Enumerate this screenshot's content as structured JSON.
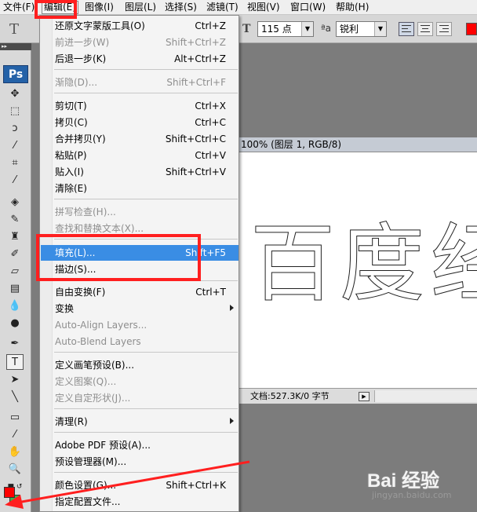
{
  "menubar": {
    "items": [
      {
        "label": "文件(F)"
      },
      {
        "label": "编辑(E)",
        "active": true
      },
      {
        "label": "图像(I)"
      },
      {
        "label": "图层(L)"
      },
      {
        "label": "选择(S)"
      },
      {
        "label": "滤镜(T)"
      },
      {
        "label": "视图(V)"
      },
      {
        "label": "窗口(W)"
      },
      {
        "label": "帮助(H)"
      }
    ]
  },
  "options_bar": {
    "font_size": "115 点",
    "antialias": "锐利",
    "color": "#ff0000"
  },
  "toolbox": {
    "logo": "Ps",
    "foreground_color": "#ff0000",
    "background_color": "#39b54a"
  },
  "document": {
    "title": "100% (图层 1, RGB/8)",
    "status": "文档:527.3K/0 字节",
    "text_chars": [
      "百",
      "度",
      "经"
    ]
  },
  "edit_menu": {
    "items": [
      {
        "label": "还原文字蒙版工具(O)",
        "shortcut": "Ctrl+Z"
      },
      {
        "label": "前进一步(W)",
        "shortcut": "Shift+Ctrl+Z",
        "disabled": true
      },
      {
        "label": "后退一步(K)",
        "shortcut": "Alt+Ctrl+Z"
      },
      {
        "label": "渐隐(D)...",
        "shortcut": "Shift+Ctrl+F",
        "disabled": true
      },
      {
        "label": "剪切(T)",
        "shortcut": "Ctrl+X"
      },
      {
        "label": "拷贝(C)",
        "shortcut": "Ctrl+C"
      },
      {
        "label": "合并拷贝(Y)",
        "shortcut": "Shift+Ctrl+C"
      },
      {
        "label": "粘贴(P)",
        "shortcut": "Ctrl+V"
      },
      {
        "label": "贴入(I)",
        "shortcut": "Shift+Ctrl+V"
      },
      {
        "label": "清除(E)",
        "shortcut": ""
      },
      {
        "label": "拼写检查(H)...",
        "shortcut": "",
        "disabled": true
      },
      {
        "label": "查找和替换文本(X)...",
        "shortcut": "",
        "disabled": true
      },
      {
        "label": "填充(L)...",
        "shortcut": "Shift+F5",
        "highlighted": true
      },
      {
        "label": "描边(S)...",
        "shortcut": ""
      },
      {
        "label": "自由变换(F)",
        "shortcut": "Ctrl+T"
      },
      {
        "label": "变换",
        "shortcut": "",
        "submenu": true
      },
      {
        "label": "Auto-Align Layers...",
        "shortcut": "",
        "disabled": true
      },
      {
        "label": "Auto-Blend Layers",
        "shortcut": "",
        "disabled": true
      },
      {
        "label": "定义画笔预设(B)...",
        "shortcut": ""
      },
      {
        "label": "定义图案(Q)...",
        "shortcut": "",
        "disabled": true
      },
      {
        "label": "定义自定形状(J)...",
        "shortcut": "",
        "disabled": true
      },
      {
        "label": "清理(R)",
        "shortcut": "",
        "submenu": true
      },
      {
        "label": "Adobe PDF 预设(A)...",
        "shortcut": ""
      },
      {
        "label": "预设管理器(M)...",
        "shortcut": ""
      },
      {
        "label": "颜色设置(G)...",
        "shortcut": "Shift+Ctrl+K"
      },
      {
        "label": "指定配置文件...",
        "shortcut": ""
      }
    ]
  },
  "watermark": {
    "logo": "Bai 经验",
    "url": "jingyan.baidu.com"
  }
}
